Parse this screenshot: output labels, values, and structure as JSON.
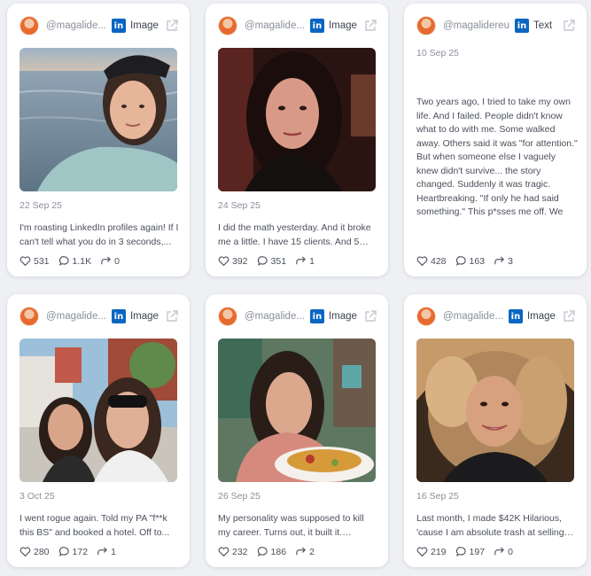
{
  "cards": [
    {
      "username": "@magalide...",
      "type_label": "Image",
      "date": "22 Sep 25",
      "caption": "I'm roasting LinkedIn profiles again! If I can't tell what you do in 3 seconds,...",
      "likes": "531",
      "comments": "1.1K",
      "reposts": "0"
    },
    {
      "username": "@magalide...",
      "type_label": "Image",
      "date": "24 Sep 25",
      "caption": "I did the math yesterday. And it broke me a little. I have 15 clients. And 5 real...",
      "likes": "392",
      "comments": "351",
      "reposts": "1"
    },
    {
      "username": "@magalidereu",
      "type_label": "Text",
      "date": "10 Sep 25",
      "caption": "Two years ago, I tried to take my own life. And I failed. People didn't know what to do with me. Some walked away. Others said it was \"for attention.\" But when someone else I vaguely knew didn't survive... the story changed. Suddenly it was tragic. Heartbreaking. \"If only he had said something.\" This p*sses me off. We grieve the dead. But we shame the living. And that silence...",
      "likes": "428",
      "comments": "163",
      "reposts": "3"
    },
    {
      "username": "@magalide...",
      "type_label": "Image",
      "date": "3 Oct 25",
      "caption": "I went rogue again. Told my PA \"f**k this BS\" and booked a hotel. Off to...",
      "likes": "280",
      "comments": "172",
      "reposts": "1"
    },
    {
      "username": "@magalide...",
      "type_label": "Image",
      "date": "26 Sep 25",
      "caption": "My personality was supposed to kill my career. Turns out, it built it. Everyone...",
      "likes": "232",
      "comments": "186",
      "reposts": "2"
    },
    {
      "username": "@magalide...",
      "type_label": "Image",
      "date": "16 Sep 25",
      "caption": "Last month, I made $42K Hilarious, 'cause I am absolute trash at selling t...",
      "likes": "219",
      "comments": "197",
      "reposts": "0"
    }
  ],
  "badge_text": "in",
  "icons": {
    "avatar": "avatar-photo",
    "platform": "linkedin-icon",
    "open": "external-link-icon",
    "like": "heart-icon",
    "comment": "comment-icon",
    "repost": "repost-icon"
  },
  "colors": {
    "linkedin": "#0a66c2",
    "background": "#eef0f4",
    "card": "#ffffff"
  }
}
